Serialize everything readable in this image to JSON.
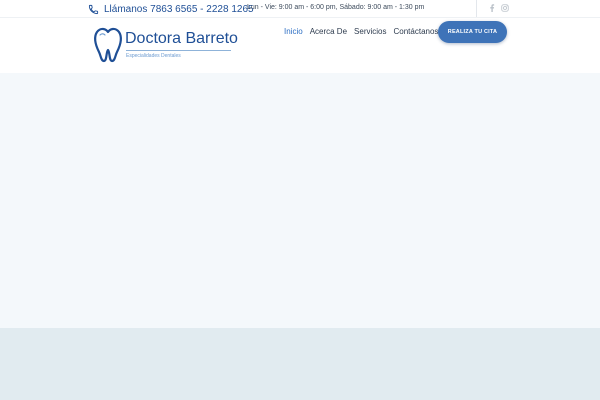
{
  "topbar": {
    "phone_text": "Llámanos 7863 6565 - 2228 1265",
    "phone_icon": "phone-icon",
    "hours_text": "Lun - Vie: 9:00 am - 6:00 pm, Sábado: 9:00 am - 1:30 pm",
    "social": [
      {
        "icon": "facebook-icon"
      },
      {
        "icon": "instagram-icon"
      }
    ]
  },
  "header": {
    "logo": {
      "name": "Doctora Barreto",
      "subtitle": "Especialidades Dentales",
      "icon": "tooth-icon"
    },
    "nav": [
      {
        "label": "Inicio",
        "active": true
      },
      {
        "label": "Acerca De",
        "active": false
      },
      {
        "label": "Servicios",
        "active": false
      },
      {
        "label": "Contáctanos",
        "active": false
      }
    ],
    "cta_label": "REALIZA TU CITA"
  },
  "colors": {
    "brand": "#1f4f96",
    "accent": "#3e73b8",
    "nav_active": "#2d6fc4",
    "hero_bg": "#f4f8fb",
    "band_bg": "#e1ebf0"
  }
}
